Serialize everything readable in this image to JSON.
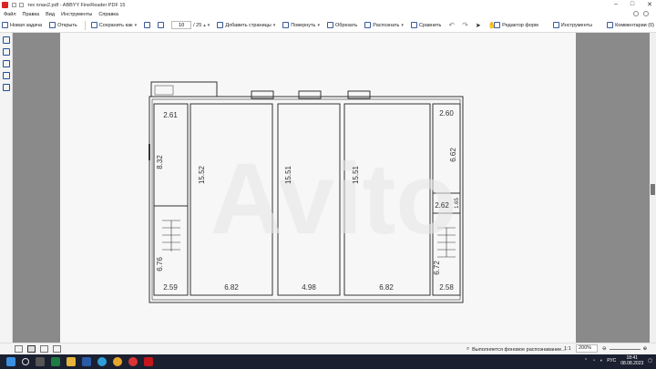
{
  "titlebar": {
    "title": "тех план2.pdf - ABBYY FineReader PDF 15"
  },
  "menu": {
    "items": [
      "Файл",
      "Правка",
      "Вид",
      "Инструменты",
      "Справка"
    ]
  },
  "toolbar": {
    "new_task": "Новая задача",
    "open": "Открыть",
    "save_as": "Сохранить как",
    "page_current": "10",
    "page_total": "/ 25",
    "add_pages": "Добавить страницы",
    "rotate": "Повернуть",
    "crop": "Обрезать",
    "recognize": "Распознать",
    "compare": "Сравнить",
    "form_editor": "Редактор форм",
    "tools": "Инструменты",
    "comments_count": "Комментарии (0)"
  },
  "plan": {
    "d1": "2.61",
    "d2": "8.32",
    "d3": "6.76",
    "d4": "2.59",
    "d5": "15.52",
    "d6": "6.82",
    "d7": "15.51",
    "d8": "4.98",
    "d9": "15.51",
    "d10": "6.82",
    "d11": "2.60",
    "d12": "6.62",
    "d13": "2.62",
    "d14": "1.65",
    "d15": "6.72",
    "d16": "2.58"
  },
  "statusbar": {
    "background_status": "Выполняется фоновое распознавание...",
    "ratio": "1:1",
    "zoom": "200%"
  },
  "taskbar": {
    "lang": "РУС",
    "time": "18:41",
    "date": "08.08.2023"
  }
}
